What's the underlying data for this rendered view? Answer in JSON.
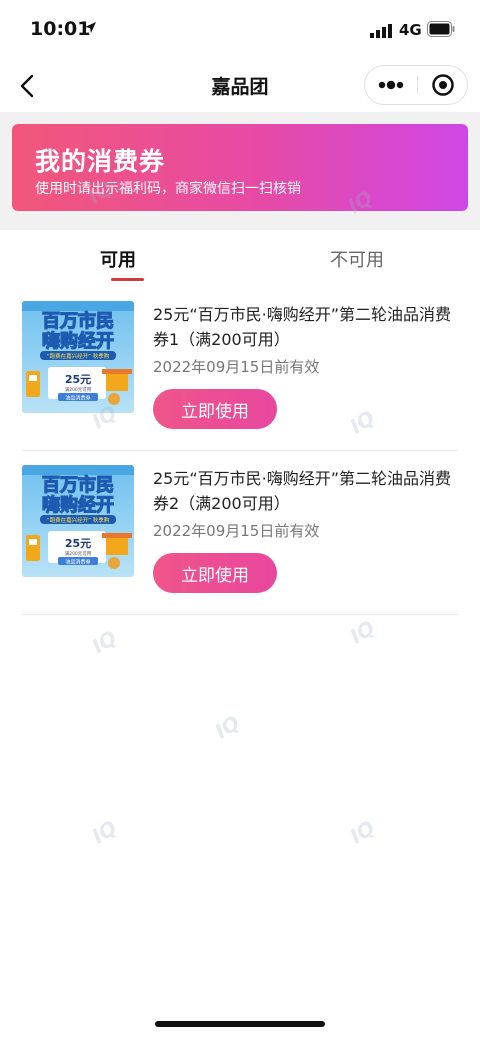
{
  "status_bar": {
    "time": "10:01",
    "network": "4G"
  },
  "nav": {
    "title": "嘉品团"
  },
  "banner": {
    "title": "我的消费券",
    "subtitle": "使用时请出示福利码，商家微信扫一扫核销"
  },
  "tabs": [
    {
      "label": "可用",
      "active": true
    },
    {
      "label": "不可用",
      "active": false
    }
  ],
  "coupons": [
    {
      "title": "25元“百万市民·嗨购经开”第二轮油品消费券1（满200可用）",
      "expire": "2022年09月15日前有效",
      "button": "立即使用",
      "image": {
        "headline1": "百万市民",
        "headline2": "嗨购经开",
        "ribbon": "“跑费在嘉兴经开” 秋季购",
        "amount": "25元",
        "condition": "满200元可用",
        "tag": "油品消费券"
      }
    },
    {
      "title": "25元“百万市民·嗨购经开”第二轮油品消费券2（满200可用）",
      "expire": "2022年09月15日前有效",
      "button": "立即使用",
      "image": {
        "headline1": "百万市民",
        "headline2": "嗨购经开",
        "ribbon": "“跑费在嘉兴经开” 秋季购",
        "amount": "25元",
        "condition": "满200元可用",
        "tag": "油品消费券"
      }
    }
  ],
  "colors": {
    "accent": "#d33a3a",
    "button": "#ea4a95",
    "banner_start": "#f2577a",
    "banner_end": "#cf47e6"
  },
  "icons": [
    "back-icon",
    "more-icon",
    "close-target-icon",
    "location-arrow-icon",
    "signal-icon",
    "battery-icon"
  ]
}
